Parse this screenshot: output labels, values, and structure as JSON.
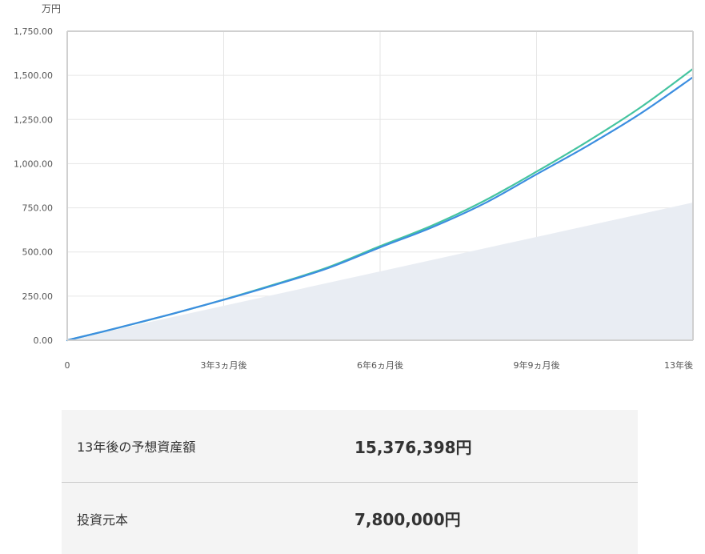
{
  "chart_data": {
    "type": "line",
    "unit_label": "万円",
    "x_tick_labels": [
      "0",
      "3年3ヵ月後",
      "6年6ヵ月後",
      "9年9ヵ月後",
      "13年後"
    ],
    "x_range_months": [
      0,
      156
    ],
    "ylim": [
      0,
      1750
    ],
    "y_ticks": [
      0,
      250,
      500,
      750,
      1000,
      1250,
      1500,
      1750
    ],
    "y_tick_labels": [
      "0.00",
      "250.00",
      "500.00",
      "750.00",
      "1,000.00",
      "1,250.00",
      "1,500.00",
      "1,750.00"
    ],
    "grid": true,
    "series": [
      {
        "kind": "area",
        "color": "#e9edf3",
        "x": [
          0,
          39,
          78,
          117,
          156
        ],
        "values": [
          0,
          195,
          390,
          585,
          780
        ]
      },
      {
        "kind": "line",
        "color": "#45c4a0",
        "x": [
          0,
          13,
          26,
          39,
          52,
          65,
          78,
          91,
          104,
          117,
          130,
          143,
          156
        ],
        "values": [
          0,
          72,
          148,
          230,
          318,
          413,
          533,
          650,
          790,
          955,
          1130,
          1320,
          1537
        ]
      },
      {
        "kind": "line",
        "color": "#3c8ee0",
        "x": [
          0,
          13,
          26,
          39,
          52,
          65,
          78,
          91,
          104,
          117,
          130,
          143,
          156
        ],
        "values": [
          0,
          72,
          148,
          229,
          315,
          408,
          526,
          640,
          775,
          940,
          1105,
          1285,
          1490
        ]
      }
    ]
  },
  "summary": {
    "rows": [
      {
        "label": "13年後の予想資産額",
        "value": "15,376,398円"
      },
      {
        "label": "投資元本",
        "value": "7,800,000円"
      }
    ]
  }
}
